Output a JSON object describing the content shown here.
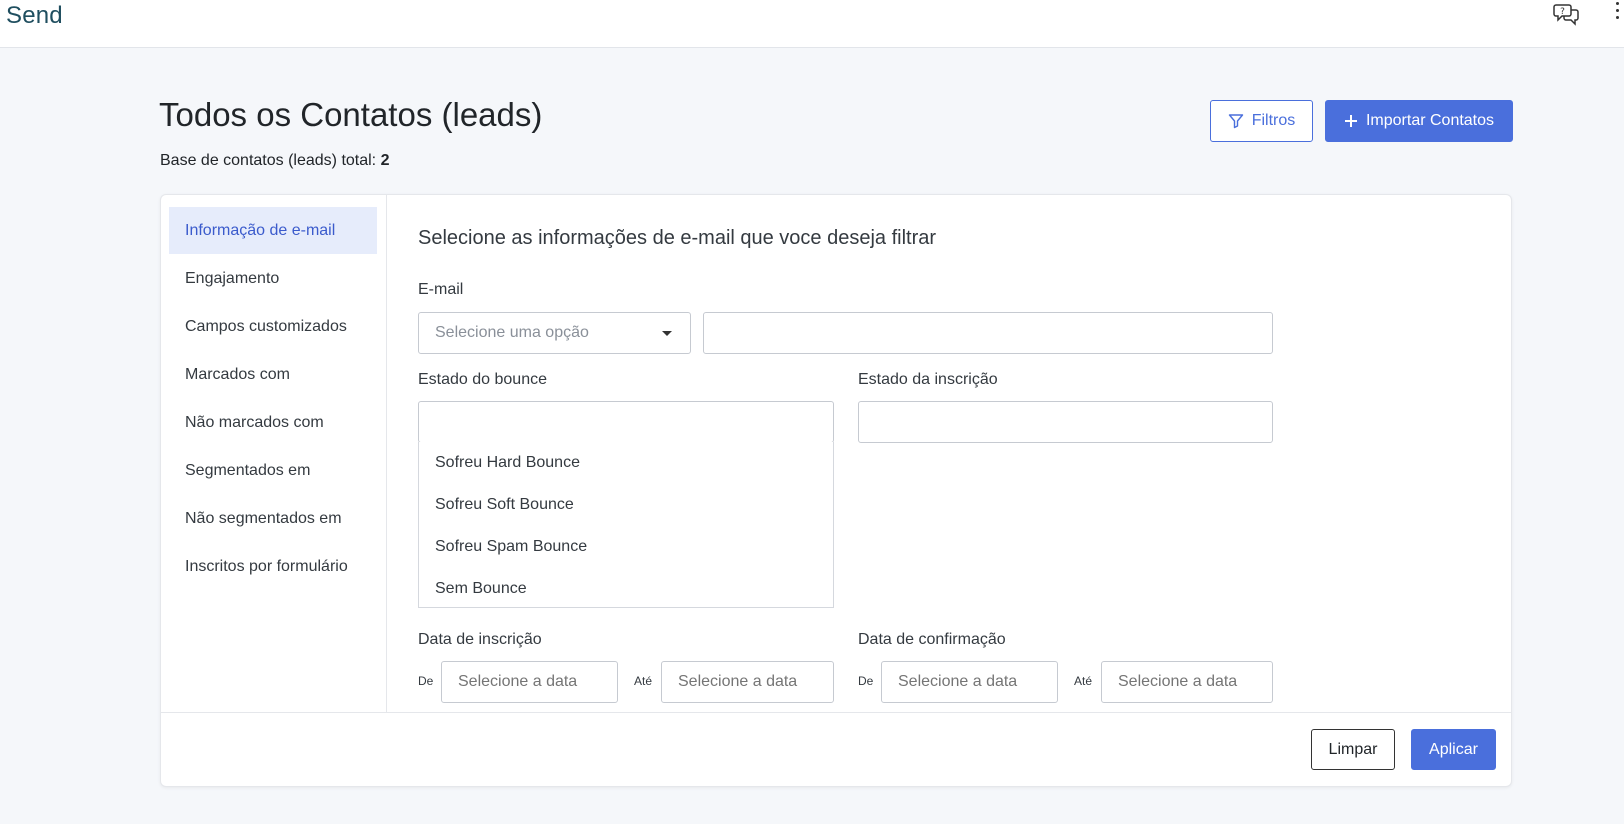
{
  "app": {
    "brand": "Send"
  },
  "header": {
    "title": "Todos os Contatos (leads)",
    "total_label": "Base de contatos (leads) total:",
    "total_value": "2",
    "filter_button": "Filtros",
    "import_button": "Importar Contatos"
  },
  "sidebar": {
    "items": [
      {
        "label": "Informação de e-mail",
        "active": true
      },
      {
        "label": "Engajamento"
      },
      {
        "label": "Campos customizados"
      },
      {
        "label": "Marcados com"
      },
      {
        "label": "Não marcados com"
      },
      {
        "label": "Segmentados em"
      },
      {
        "label": "Não segmentados em"
      },
      {
        "label": "Inscritos por formulário"
      }
    ]
  },
  "form": {
    "section_title": "Selecione as informações de e-mail que voce deseja filtrar",
    "email": {
      "label": "E-mail",
      "select_placeholder": "Selecione uma opção",
      "value": ""
    },
    "bounce": {
      "label": "Estado do bounce",
      "value": "",
      "options": [
        "Sofreu Hard Bounce",
        "Sofreu Soft Bounce",
        "Sofreu Spam Bounce",
        "Sem Bounce"
      ]
    },
    "subscription": {
      "label": "Estado da inscrição",
      "value": ""
    },
    "signup_date": {
      "label": "Data de inscrição",
      "from_label": "De",
      "to_label": "Até",
      "from_placeholder": "Selecione a data",
      "to_placeholder": "Selecione a data"
    },
    "confirm_date": {
      "label": "Data de confirmação",
      "from_label": "De",
      "to_label": "Até",
      "from_placeholder": "Selecione a data",
      "to_placeholder": "Selecione a data"
    }
  },
  "footer": {
    "clear_button": "Limpar",
    "apply_button": "Aplicar"
  },
  "colors": {
    "primary": "#4a6fdc",
    "active_bg": "#e6ecfb",
    "brand_text": "#1f4e5f"
  },
  "icons": {
    "help": "chat-help-icon",
    "menu": "kebab-menu-icon",
    "filter": "filter-icon",
    "plus": "plus-icon",
    "caret": "caret-down-icon"
  }
}
